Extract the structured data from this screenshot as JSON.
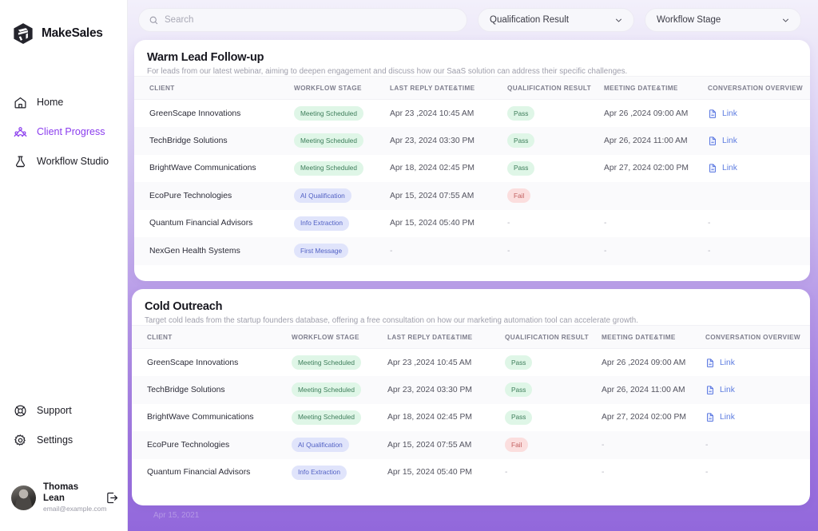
{
  "brand": {
    "name": "MakeSales",
    "logo_icon": "hexagon-logo-icon"
  },
  "sidebar": {
    "items": [
      {
        "label": "Home",
        "icon": "home-icon",
        "active": false
      },
      {
        "label": "Client Progress",
        "icon": "users-group-icon",
        "active": true
      },
      {
        "label": "Workflow Studio",
        "icon": "flask-icon",
        "active": false
      }
    ],
    "bottom_items": [
      {
        "label": "Support",
        "icon": "lifebuoy-icon"
      },
      {
        "label": "Settings",
        "icon": "gear-icon"
      }
    ],
    "user": {
      "name": "Thomas Lean",
      "email": "email@example.com",
      "avatar_icon": "avatar",
      "logout_icon": "logout-icon"
    }
  },
  "topbar": {
    "search": {
      "placeholder": "Search",
      "value": "",
      "icon": "search-icon"
    },
    "filters": [
      {
        "label": "Qualification Result",
        "icon": "chevron-down-icon"
      },
      {
        "label": "Workflow Stage",
        "icon": "chevron-down-icon"
      }
    ]
  },
  "columns": [
    "CLIENT",
    "WORKFLOW STAGE",
    "LAST REPLY DATE&TIME",
    "QUALIFICATION RESULT",
    "MEETING DATE&TIME",
    "CONVERSATION OVERVIEW"
  ],
  "cards": [
    {
      "title": "Warm Lead Follow-up",
      "subtitle": "For leads from our latest webinar, aiming to deepen engagement and discuss how our SaaS solution can address their specific challenges.",
      "rows": [
        {
          "client": "GreenScape Innovations",
          "stage": "Meeting Scheduled",
          "stage_tone": "green",
          "last_reply": "Apr 23 ,2024 10:45 AM",
          "qualification": "Pass",
          "qual_tone": "pass",
          "meeting": "Apr 26 ,2024 09:00 AM",
          "conversation": "Link"
        },
        {
          "client": "TechBridge Solutions",
          "stage": "Meeting Scheduled",
          "stage_tone": "green",
          "last_reply": "Apr 23, 2024 03:30 PM",
          "qualification": "Pass",
          "qual_tone": "pass",
          "meeting": "Apr 26, 2024 11:00 AM",
          "conversation": "Link"
        },
        {
          "client": "BrightWave Communications",
          "stage": "Meeting Scheduled",
          "stage_tone": "green",
          "last_reply": "Apr 18, 2024 02:45 PM",
          "qualification": "Pass",
          "qual_tone": "pass",
          "meeting": "Apr 27, 2024 02:00 PM",
          "conversation": "Link"
        },
        {
          "client": "EcoPure Technologies",
          "stage": "AI Qualification",
          "stage_tone": "blue",
          "last_reply": "Apr 15, 2024 07:55 AM",
          "qualification": "Fail",
          "qual_tone": "fail",
          "meeting": "",
          "conversation": ""
        },
        {
          "client": "Quantum Financial Advisors",
          "stage": "Info Extraction",
          "stage_tone": "blue",
          "last_reply": "Apr 15, 2024 05:40 PM",
          "qualification": "-",
          "qual_tone": "dash",
          "meeting": "-",
          "conversation": "-"
        },
        {
          "client": "NexGen Health Systems",
          "stage": "First Message",
          "stage_tone": "blue",
          "last_reply": "-",
          "qualification": "-",
          "qual_tone": "dash",
          "meeting": "-",
          "conversation": "-"
        }
      ]
    },
    {
      "title": "Cold Outreach",
      "subtitle": "Target cold leads from the startup founders database, offering a free consultation on how our marketing automation tool can accelerate growth.",
      "rows": [
        {
          "client": "GreenScape Innovations",
          "stage": "Meeting Scheduled",
          "stage_tone": "green",
          "last_reply": "Apr 23 ,2024 10:45 AM",
          "qualification": "Pass",
          "qual_tone": "pass",
          "meeting": "Apr 26 ,2024 09:00 AM",
          "conversation": "Link"
        },
        {
          "client": "TechBridge Solutions",
          "stage": "Meeting Scheduled",
          "stage_tone": "green",
          "last_reply": "Apr 23, 2024 03:30 PM",
          "qualification": "Pass",
          "qual_tone": "pass",
          "meeting": "Apr 26, 2024 11:00 AM",
          "conversation": "Link"
        },
        {
          "client": "BrightWave Communications",
          "stage": "Meeting Scheduled",
          "stage_tone": "green",
          "last_reply": "Apr 18, 2024 02:45 PM",
          "qualification": "Pass",
          "qual_tone": "pass",
          "meeting": "Apr 27, 2024 02:00 PM",
          "conversation": "Link"
        },
        {
          "client": "EcoPure Technologies",
          "stage": "AI Qualification",
          "stage_tone": "blue",
          "last_reply": "Apr 15, 2024 07:55 AM",
          "qualification": "Fail",
          "qual_tone": "fail",
          "meeting": "-",
          "conversation": "-"
        },
        {
          "client": "Quantum Financial Advisors",
          "stage": "Info Extraction",
          "stage_tone": "blue",
          "last_reply": "Apr 15, 2024 05:40 PM",
          "qualification": "-",
          "qual_tone": "dash",
          "meeting": "-",
          "conversation": "-"
        }
      ]
    }
  ],
  "footer": {
    "stamp": "Apr 15, 2021"
  },
  "colors": {
    "accent_purple": "#8b3dee",
    "background_purple": "#9268db",
    "badge_green_bg": "#dff6e7",
    "badge_blue_bg": "#e0e4fb",
    "badge_fail_bg": "#fbdede",
    "link_blue": "#5d7ce0"
  }
}
